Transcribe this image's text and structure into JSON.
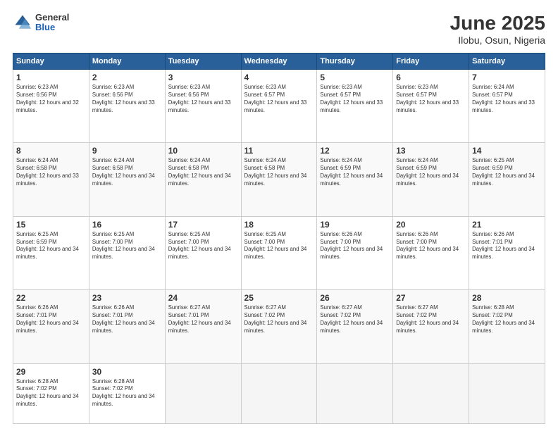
{
  "header": {
    "logo_general": "General",
    "logo_blue": "Blue",
    "title": "June 2025",
    "subtitle": "Ilobu, Osun, Nigeria"
  },
  "days_of_week": [
    "Sunday",
    "Monday",
    "Tuesday",
    "Wednesday",
    "Thursday",
    "Friday",
    "Saturday"
  ],
  "weeks": [
    [
      {
        "day": "1",
        "sunrise": "6:23 AM",
        "sunset": "6:56 PM",
        "daylight": "12 hours and 32 minutes."
      },
      {
        "day": "2",
        "sunrise": "6:23 AM",
        "sunset": "6:56 PM",
        "daylight": "12 hours and 33 minutes."
      },
      {
        "day": "3",
        "sunrise": "6:23 AM",
        "sunset": "6:56 PM",
        "daylight": "12 hours and 33 minutes."
      },
      {
        "day": "4",
        "sunrise": "6:23 AM",
        "sunset": "6:57 PM",
        "daylight": "12 hours and 33 minutes."
      },
      {
        "day": "5",
        "sunrise": "6:23 AM",
        "sunset": "6:57 PM",
        "daylight": "12 hours and 33 minutes."
      },
      {
        "day": "6",
        "sunrise": "6:23 AM",
        "sunset": "6:57 PM",
        "daylight": "12 hours and 33 minutes."
      },
      {
        "day": "7",
        "sunrise": "6:24 AM",
        "sunset": "6:57 PM",
        "daylight": "12 hours and 33 minutes."
      }
    ],
    [
      {
        "day": "8",
        "sunrise": "6:24 AM",
        "sunset": "6:58 PM",
        "daylight": "12 hours and 33 minutes."
      },
      {
        "day": "9",
        "sunrise": "6:24 AM",
        "sunset": "6:58 PM",
        "daylight": "12 hours and 34 minutes."
      },
      {
        "day": "10",
        "sunrise": "6:24 AM",
        "sunset": "6:58 PM",
        "daylight": "12 hours and 34 minutes."
      },
      {
        "day": "11",
        "sunrise": "6:24 AM",
        "sunset": "6:58 PM",
        "daylight": "12 hours and 34 minutes."
      },
      {
        "day": "12",
        "sunrise": "6:24 AM",
        "sunset": "6:59 PM",
        "daylight": "12 hours and 34 minutes."
      },
      {
        "day": "13",
        "sunrise": "6:24 AM",
        "sunset": "6:59 PM",
        "daylight": "12 hours and 34 minutes."
      },
      {
        "day": "14",
        "sunrise": "6:25 AM",
        "sunset": "6:59 PM",
        "daylight": "12 hours and 34 minutes."
      }
    ],
    [
      {
        "day": "15",
        "sunrise": "6:25 AM",
        "sunset": "6:59 PM",
        "daylight": "12 hours and 34 minutes."
      },
      {
        "day": "16",
        "sunrise": "6:25 AM",
        "sunset": "7:00 PM",
        "daylight": "12 hours and 34 minutes."
      },
      {
        "day": "17",
        "sunrise": "6:25 AM",
        "sunset": "7:00 PM",
        "daylight": "12 hours and 34 minutes."
      },
      {
        "day": "18",
        "sunrise": "6:25 AM",
        "sunset": "7:00 PM",
        "daylight": "12 hours and 34 minutes."
      },
      {
        "day": "19",
        "sunrise": "6:26 AM",
        "sunset": "7:00 PM",
        "daylight": "12 hours and 34 minutes."
      },
      {
        "day": "20",
        "sunrise": "6:26 AM",
        "sunset": "7:00 PM",
        "daylight": "12 hours and 34 minutes."
      },
      {
        "day": "21",
        "sunrise": "6:26 AM",
        "sunset": "7:01 PM",
        "daylight": "12 hours and 34 minutes."
      }
    ],
    [
      {
        "day": "22",
        "sunrise": "6:26 AM",
        "sunset": "7:01 PM",
        "daylight": "12 hours and 34 minutes."
      },
      {
        "day": "23",
        "sunrise": "6:26 AM",
        "sunset": "7:01 PM",
        "daylight": "12 hours and 34 minutes."
      },
      {
        "day": "24",
        "sunrise": "6:27 AM",
        "sunset": "7:01 PM",
        "daylight": "12 hours and 34 minutes."
      },
      {
        "day": "25",
        "sunrise": "6:27 AM",
        "sunset": "7:02 PM",
        "daylight": "12 hours and 34 minutes."
      },
      {
        "day": "26",
        "sunrise": "6:27 AM",
        "sunset": "7:02 PM",
        "daylight": "12 hours and 34 minutes."
      },
      {
        "day": "27",
        "sunrise": "6:27 AM",
        "sunset": "7:02 PM",
        "daylight": "12 hours and 34 minutes."
      },
      {
        "day": "28",
        "sunrise": "6:28 AM",
        "sunset": "7:02 PM",
        "daylight": "12 hours and 34 minutes."
      }
    ],
    [
      {
        "day": "29",
        "sunrise": "6:28 AM",
        "sunset": "7:02 PM",
        "daylight": "12 hours and 34 minutes."
      },
      {
        "day": "30",
        "sunrise": "6:28 AM",
        "sunset": "7:02 PM",
        "daylight": "12 hours and 34 minutes."
      },
      null,
      null,
      null,
      null,
      null
    ]
  ]
}
